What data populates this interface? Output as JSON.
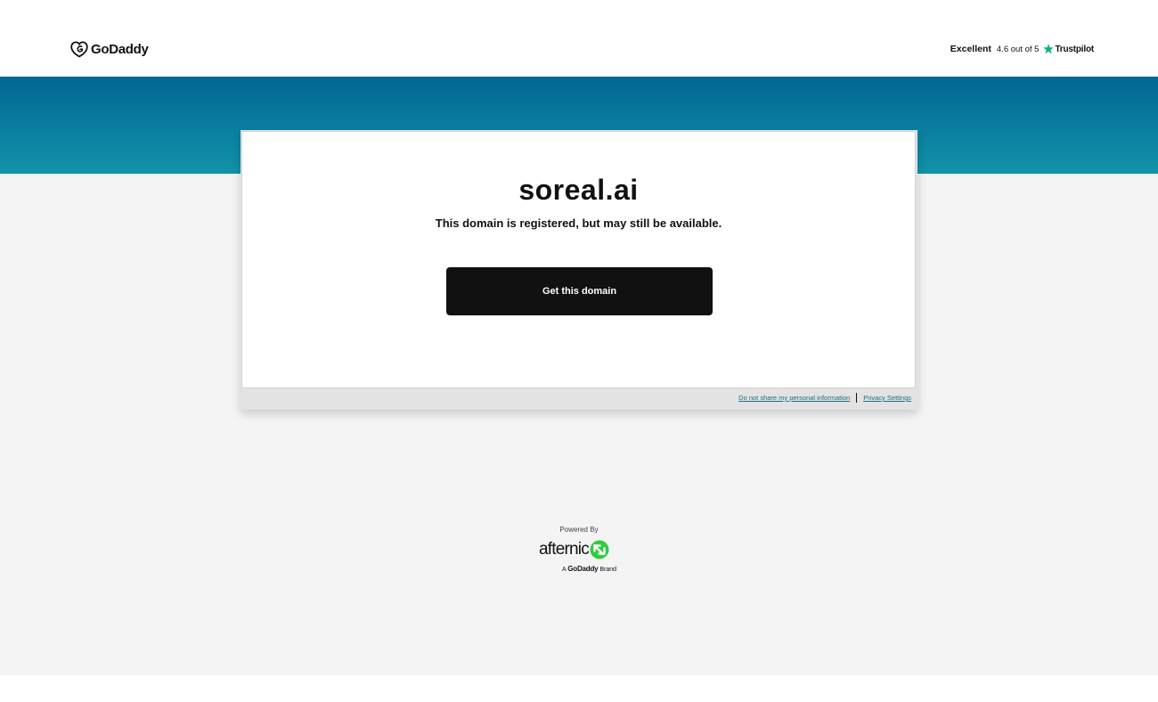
{
  "header": {
    "logo_text": "GoDaddy",
    "trustpilot": {
      "rating_word": "Excellent",
      "score_text": "4.6 out of 5",
      "brand": "Trustpilot"
    }
  },
  "card": {
    "domain": "soreal.ai",
    "subtitle": "This domain is registered, but may still be available.",
    "button_label": "Get this domain"
  },
  "legal": {
    "do_not_share": "Do not share my personal information",
    "privacy_settings": "Privacy Settings"
  },
  "footer": {
    "powered_by": "Powered By",
    "afternic_text": "afternic",
    "brand_prefix": "A",
    "brand_name": "GoDaddy",
    "brand_suffix": "Brand"
  },
  "colors": {
    "banner_top": "#036693",
    "banner_bottom": "#1293a8",
    "trustpilot_green": "#00b67a",
    "afternic_green": "#2ecc40",
    "button": "#111111",
    "link": "#1c6e7d"
  }
}
